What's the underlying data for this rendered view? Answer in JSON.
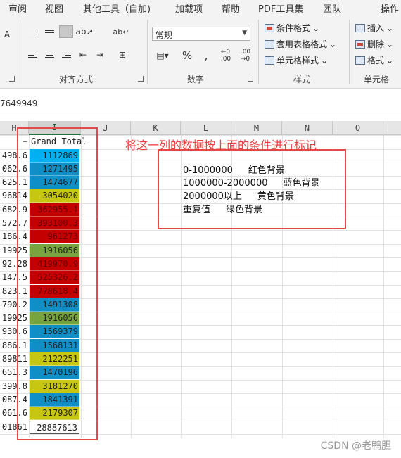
{
  "ribbon": {
    "tabs": [
      "审阅",
      "视图",
      "其他工具（自加)",
      "加载项",
      "帮助",
      "PDF工具集",
      "团队",
      "操作"
    ],
    "group_labels": {
      "alignment": "对齐方式",
      "number": "数字",
      "styles": "样式",
      "cells": "单元格"
    },
    "number_format": "常规",
    "percent_symbol": "%",
    "comma_symbol": ",",
    "styles_buttons": [
      "条件格式",
      "套用表格格式",
      "单元格样式"
    ],
    "cells_buttons": [
      "插入",
      "删除",
      "格式"
    ]
  },
  "formula_bar": {
    "value": "7649949"
  },
  "sheet": {
    "column_headers": [
      "H",
      "I",
      "J",
      "K",
      "L",
      "M",
      "N",
      "O"
    ],
    "selected_column": "I",
    "h_column": [
      "−",
      "498.6",
      "062.6",
      "625.1",
      "96814",
      "682.9",
      "572.7",
      "186.4",
      "19925",
      "92.28",
      "147.5",
      "823.1",
      "790.2",
      "19925",
      "930.6",
      "886.1",
      "89811",
      "651.3",
      "399.8",
      "087.4",
      "061.6",
      "01861"
    ],
    "i_header": "Grand Total",
    "i_values": [
      {
        "value": "1112869",
        "color": "cyan"
      },
      {
        "value": "1271495",
        "color": "blue"
      },
      {
        "value": "1474677",
        "color": "blue"
      },
      {
        "value": "3054020",
        "color": "yellow"
      },
      {
        "value": "362955.1",
        "color": "red"
      },
      {
        "value": "393100.3",
        "color": "red"
      },
      {
        "value": "961273",
        "color": "red"
      },
      {
        "value": "1916056",
        "color": "green"
      },
      {
        "value": "419970.9",
        "color": "red"
      },
      {
        "value": "525326.2",
        "color": "red"
      },
      {
        "value": "778618.4",
        "color": "red"
      },
      {
        "value": "1491308",
        "color": "blue"
      },
      {
        "value": "1916056",
        "color": "green"
      },
      {
        "value": "1569379",
        "color": "blue"
      },
      {
        "value": "1568131",
        "color": "blue"
      },
      {
        "value": "2122251",
        "color": "yellow"
      },
      {
        "value": "1470196",
        "color": "blue"
      },
      {
        "value": "3181270",
        "color": "yellow"
      },
      {
        "value": "1841391",
        "color": "blue"
      },
      {
        "value": "2179307",
        "color": "yellow"
      },
      {
        "value": "28887613",
        "color": "total"
      }
    ]
  },
  "legend": [
    {
      "range": "0-1000000",
      "label": "红色背景"
    },
    {
      "range": "1000000-2000000",
      "label": "蓝色背景"
    },
    {
      "range": "2000000以上",
      "label": "黄色背景"
    },
    {
      "range": "重复值",
      "label": "绿色背景"
    }
  ],
  "note": "将这一列的数据按上面的条件进行标记",
  "watermark": "CSDN @老鸭胆",
  "colors": {
    "cyan": "#00b0f0",
    "blue": "#0f8fc6",
    "yellow": "#c7c711",
    "red": "#c40000",
    "green": "#78a43f",
    "annotation": "#e44a4a",
    "selection": "#217346"
  }
}
